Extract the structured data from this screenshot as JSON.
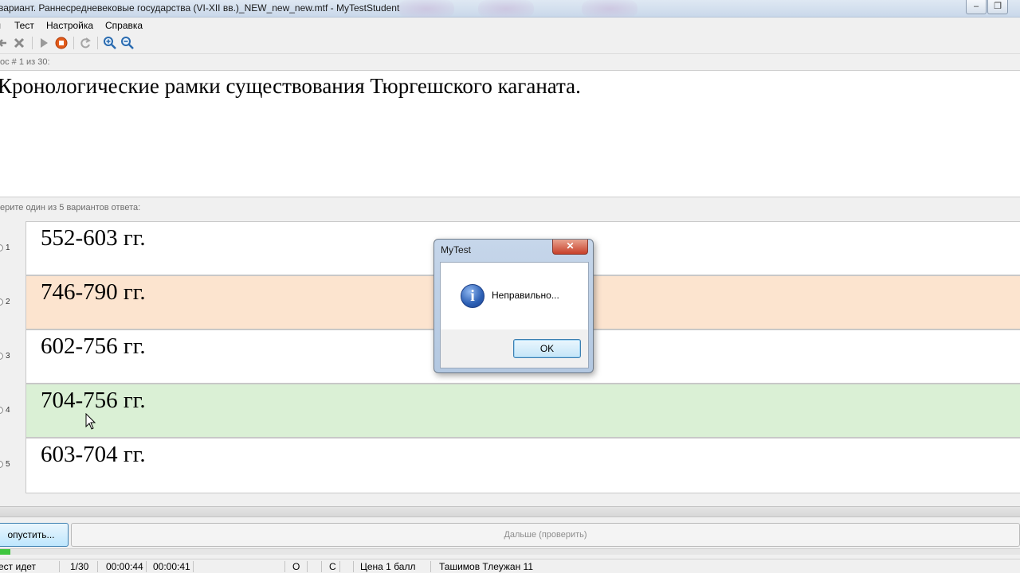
{
  "window": {
    "title": "вариант. Раннесредневековые государства (VI-XII вв.)_NEW_new_new.mtf - MyTestStudent",
    "restore_glyph": "❐"
  },
  "menu": {
    "items": [
      "Тест",
      "Настройка",
      "Справка"
    ]
  },
  "toolbar": {
    "icons": [
      "back-icon",
      "stop-x-icon",
      "play-icon",
      "stop-record-icon",
      "refresh-icon",
      "zoom-in-icon",
      "zoom-out-icon"
    ]
  },
  "question": {
    "counter": "ос # 1 из 30:",
    "text": "Кронологические рамки существования Тюргешского каганата."
  },
  "answers": {
    "prompt": "ерите один из 5 вариантов ответа:",
    "items": [
      {
        "num": "1",
        "text": "552-603 гг.",
        "state": "normal"
      },
      {
        "num": "2",
        "text": "746-790 гг.",
        "state": "wrong"
      },
      {
        "num": "3",
        "text": "602-756 гг.",
        "state": "normal"
      },
      {
        "num": "4",
        "text": "704-756 гг.",
        "state": "correct"
      },
      {
        "num": "5",
        "text": "603-704 гг.",
        "state": "normal"
      }
    ]
  },
  "buttons": {
    "skip": "опустить...",
    "next": "Дальше (проверить)"
  },
  "progress": {
    "fraction": 0.01
  },
  "status": {
    "state": "ест идет",
    "count": "1/30",
    "time1": "00:00:44",
    "time2": "00:00:41",
    "o": "О",
    "c": "С",
    "price": "Цена 1 балл",
    "user": "Ташимов Тлеужан 11"
  },
  "dialog": {
    "title": "MyTest",
    "close": "✕",
    "message": "Неправильно...",
    "ok": "OK",
    "icon": "info-icon",
    "icon_glyph": "i"
  },
  "colors": {
    "wrong": "#fce4cf",
    "correct": "#daf0d5"
  }
}
